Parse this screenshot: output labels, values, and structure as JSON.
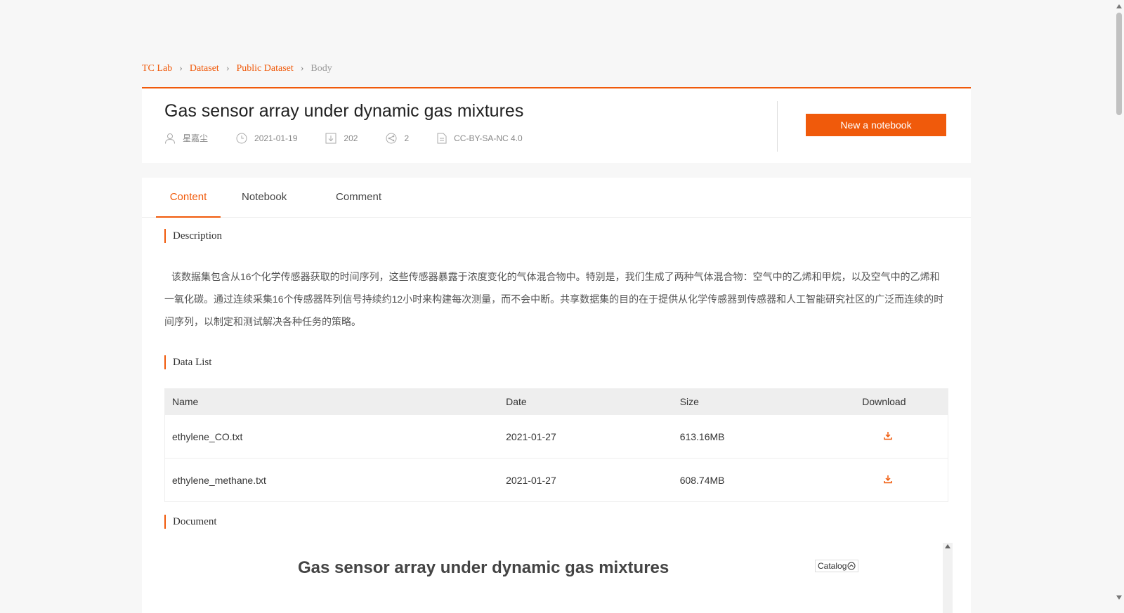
{
  "breadcrumb": {
    "items": [
      "TC Lab",
      "Dataset",
      "Public Dataset",
      "Body"
    ]
  },
  "dataset": {
    "title": "Gas sensor array under dynamic gas mixtures",
    "author": "星嘉尘",
    "date": "2021-01-19",
    "downloads": "202",
    "shares": "2",
    "license": "CC-BY-SA-NC 4.0",
    "new_notebook_label": "New a notebook"
  },
  "tabs": [
    {
      "label": "Content",
      "active": true
    },
    {
      "label": "Notebook",
      "active": false
    },
    {
      "label": "Comment",
      "active": false
    }
  ],
  "sections": {
    "description_title": "Description",
    "description_text": "该数据集包含从16个化学传感器获取的时间序列，这些传感器暴露于浓度变化的气体混合物中。特别是，我们生成了两种气体混合物：空气中的乙烯和甲烷，以及空气中的乙烯和一氧化碳。通过连续采集16个传感器阵列信号持续约12小时来构建每次测量，而不会中断。共享数据集的目的在于提供从化学传感器到传感器和人工智能研究社区的广泛而连续的时间序列，以制定和测试解决各种任务的策略。",
    "datalist_title": "Data List",
    "document_title": "Document"
  },
  "data_table": {
    "headers": {
      "name": "Name",
      "date": "Date",
      "size": "Size",
      "download": "Download"
    },
    "rows": [
      {
        "name": "ethylene_CO.txt",
        "date": "2021-01-27",
        "size": "613.16MB"
      },
      {
        "name": "ethylene_methane.txt",
        "date": "2021-01-27",
        "size": "608.74MB"
      }
    ]
  },
  "document": {
    "heading": "Gas sensor array under dynamic gas mixtures",
    "catalog_label": "Catalog"
  },
  "colors": {
    "accent": "#f05a0b",
    "background": "#f7f7f7"
  },
  "icons": [
    "user-icon",
    "clock-icon",
    "download-icon",
    "share-icon",
    "document-icon",
    "chevron-right-icon",
    "catalog-toggle-icon"
  ]
}
